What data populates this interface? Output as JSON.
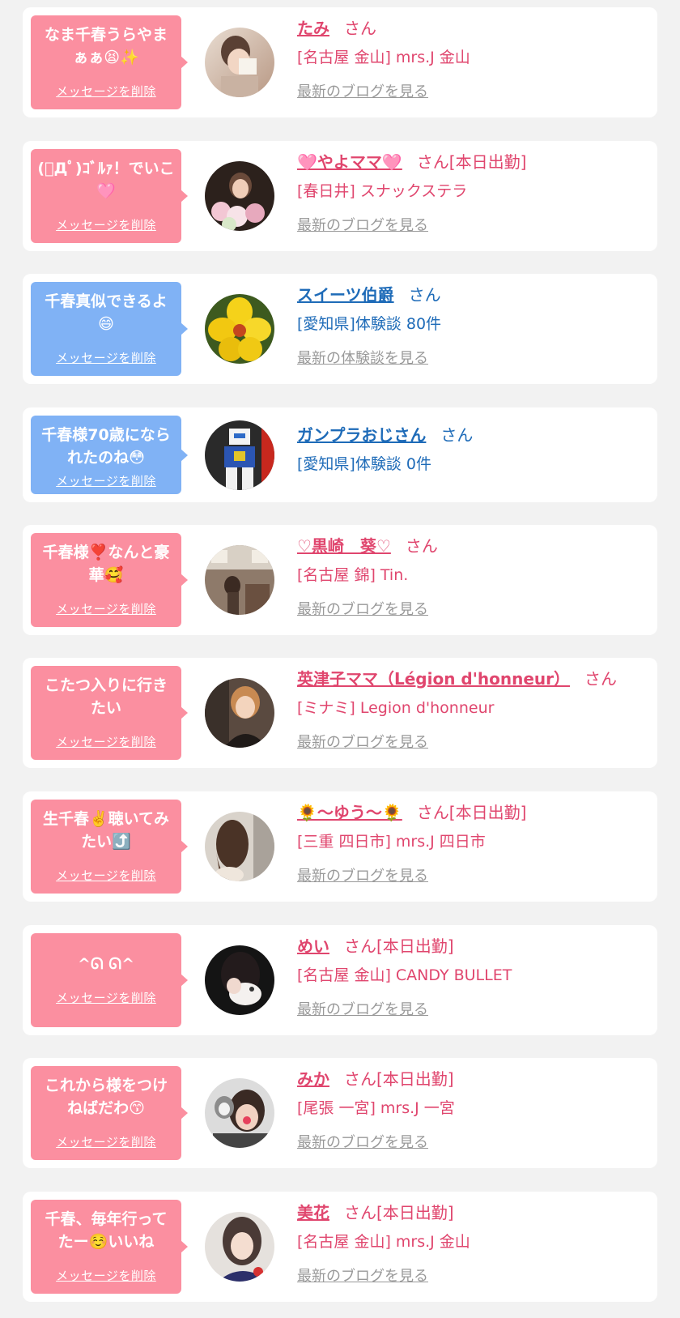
{
  "delete_label": "メッセージを削除",
  "items": [
    {
      "message": "なま千春うらやまぁぁ😫✨",
      "name": "たみ",
      "suffix": "さん",
      "shop": "[名古屋 金山] mrs.J 金山",
      "link": "最新のブログを見る",
      "kind": "cast"
    },
    {
      "message": "(ﾟДﾟ)ｺﾞﾙｧ！でいこ🩷",
      "name": "🩷やよママ🩷",
      "suffix": "さん[本日出勤]",
      "shop": "[春日井] スナックステラ",
      "link": "最新のブログを見る",
      "kind": "cast"
    },
    {
      "message": "千春真似できるよ😄",
      "name": "スイーツ伯爵",
      "suffix": "さん",
      "shop": "[愛知県]体験談 80件",
      "link": "最新の体験談を見る",
      "kind": "user"
    },
    {
      "message": "千春様70歳になられたのね😳",
      "name": "ガンプラおじさん",
      "suffix": "さん",
      "shop": "[愛知県]体験談 0件",
      "link": "",
      "kind": "user"
    },
    {
      "message": "千春様❣️なんと豪華🥰",
      "name": "♡黒崎　葵♡",
      "suffix": "さん",
      "shop": "[名古屋 錦] Tin.",
      "link": "最新のブログを見る",
      "kind": "cast"
    },
    {
      "message": "こたつ入りに行きたい",
      "name": "英津子ママ（Légion d'honneur）",
      "suffix": "さん",
      "shop": "[ミナミ] Legion d'honneur",
      "link": "最新のブログを見る",
      "kind": "cast"
    },
    {
      "message": "生千春✌️聴いてみたい⤴️",
      "name": "🌻〜ゆう〜🌻",
      "suffix": "さん[本日出勤]",
      "shop": "[三重 四日市] mrs.J 四日市",
      "link": "最新のブログを見る",
      "kind": "cast"
    },
    {
      "message": "^ᘏ ᘏ^",
      "name": "めい",
      "suffix": "さん[本日出勤]",
      "shop": "[名古屋 金山] CANDY BULLET",
      "link": "最新のブログを見る",
      "kind": "cast"
    },
    {
      "message": "これから様をつけねばだわ😙",
      "name": "みか",
      "suffix": "さん[本日出勤]",
      "shop": "[尾張 一宮] mrs.J 一宮",
      "link": "最新のブログを見る",
      "kind": "cast"
    },
    {
      "message": "千春、毎年行ってたー☺️いいね",
      "name": "美花",
      "suffix": "さん[本日出勤]",
      "shop": "[名古屋 金山] mrs.J 金山",
      "link": "最新のブログを見る",
      "kind": "cast"
    }
  ],
  "colors": {
    "cast_bubble": "#fb8fa0",
    "user_bubble": "#80b2f5",
    "cast_text": "#e0466e",
    "user_text": "#1e6bb8",
    "link_gray": "#999999"
  }
}
